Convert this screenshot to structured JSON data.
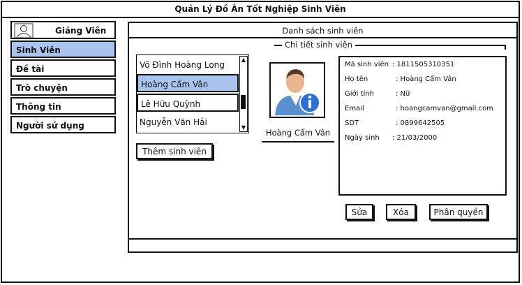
{
  "app": {
    "title": "Quản Lý Đồ Án Tốt Nghiệp Sinh Viên"
  },
  "sidebar": {
    "role_label": "Giảng Viên",
    "items": [
      {
        "label": "Sinh Viên",
        "active": true
      },
      {
        "label": "Đề tài"
      },
      {
        "label": "Trò chuyện"
      },
      {
        "label": "Thông tin"
      },
      {
        "label": "Người sử dụng"
      }
    ]
  },
  "panel": {
    "title": "Danh sách sinh viên"
  },
  "student_list": {
    "items": [
      {
        "name": "Võ Đình Hoàng Long"
      },
      {
        "name": "Hoàng Cẩm Vân",
        "selected": true
      },
      {
        "name": "Lê Hữu Quỳnh"
      },
      {
        "name": "Nguyễn Văn Hải"
      }
    ],
    "add_button": "Thêm sinh viên"
  },
  "detail": {
    "legend": "Chi tiết sinh viên",
    "name_caption": "Hoàng Cẩm Vân",
    "fields": [
      {
        "label": "Mã sinh viên",
        "value": ": 1811505310351"
      },
      {
        "label": "Họ tên",
        "value": ": Hoàng Cẩm Vân"
      },
      {
        "label": "Giới tính",
        "value": ": Nữ"
      },
      {
        "label": "Email",
        "value": ": hoangcamvan@gmail.com"
      },
      {
        "label": "SDT",
        "value": ": 0899642505"
      },
      {
        "label": "Ngày sinh",
        "value": ": 21/03/2000"
      }
    ],
    "buttons": {
      "edit": "Sửa",
      "delete": "Xóa",
      "permissions": "Phân quyền"
    }
  },
  "colors": {
    "highlight": "#a9c4ef",
    "info_badge": "#2a6fd6"
  }
}
